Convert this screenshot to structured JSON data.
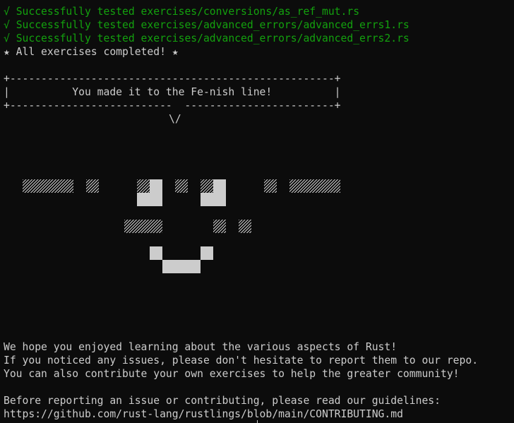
{
  "terminal": {
    "results": [
      {
        "check": "√",
        "text": "Successfully tested exercises/conversions/as_ref_mut.rs"
      },
      {
        "check": "√",
        "text": "Successfully tested exercises/advanced_errors/advanced_errs1.rs"
      },
      {
        "check": "√",
        "text": "Successfully tested exercises/advanced_errors/advanced_errs2.rs"
      }
    ],
    "completed": "★ All exercises completed! ★",
    "banner": {
      "top": "+----------------------------------------------------+",
      "middle": "|          You made it to the Fe-nish line!          |",
      "bottom": "+--------------------------  ------------------------+",
      "pointer": "\\/"
    },
    "message_lines": [
      "We hope you enjoyed learning about the various aspects of Rust!",
      "If you noticed any issues, please don't hesitate to report them to our repo.",
      "You can also contribute your own exercises to help the greater community!",
      "",
      "Before reporting an issue or contributing, please read our guidelines:",
      "https://github.com/rust-lang/rustlings/blob/main/CONTRIBUTING.md"
    ],
    "colors": {
      "background": "#0c0c0c",
      "foreground": "#cccccc",
      "success": "#13a10e"
    }
  }
}
